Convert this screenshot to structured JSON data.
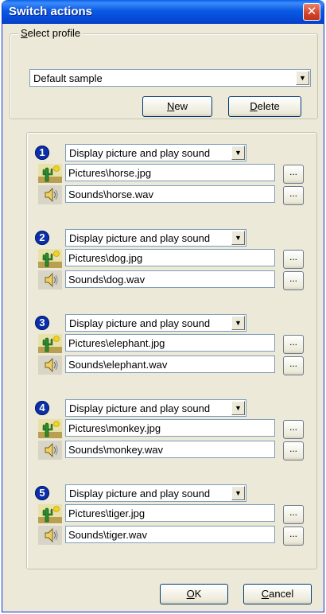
{
  "window": {
    "title": "Switch actions",
    "close_glyph": "✕"
  },
  "profile": {
    "legend_prefix": "S",
    "legend_rest": "elect profile",
    "selected": "Default sample",
    "new_prefix": "N",
    "new_rest": "ew",
    "delete_prefix": "D",
    "delete_rest": "elete"
  },
  "switches": [
    {
      "number": "1",
      "action": "Display picture and play sound",
      "picture": "Pictures\\horse.jpg",
      "sound": "Sounds\\horse.wav",
      "browse": "..."
    },
    {
      "number": "2",
      "action": "Display picture and play sound",
      "picture": "Pictures\\dog.jpg",
      "sound": "Sounds\\dog.wav",
      "browse": "..."
    },
    {
      "number": "3",
      "action": "Display picture and play sound",
      "picture": "Pictures\\elephant.jpg",
      "sound": "Sounds\\elephant.wav",
      "browse": "..."
    },
    {
      "number": "4",
      "action": "Display picture and play sound",
      "picture": "Pictures\\monkey.jpg",
      "sound": "Sounds\\monkey.wav",
      "browse": "..."
    },
    {
      "number": "5",
      "action": "Display picture and play sound",
      "picture": "Pictures\\tiger.jpg",
      "sound": "Sounds\\tiger.wav",
      "browse": "..."
    }
  ],
  "footer": {
    "ok_prefix": "O",
    "ok_rest": "K",
    "cancel_prefix": "C",
    "cancel_rest": "ancel"
  },
  "colors": {
    "titlebar": "#0a5ae3",
    "dialog_bg": "#ece9d8",
    "close_button": "#d2432a",
    "number_badge": "#0b2fa8"
  },
  "icons": {
    "picture": "picture-cactus-icon",
    "sound": "speaker-icon",
    "dropdown": "chevron-down-icon"
  }
}
